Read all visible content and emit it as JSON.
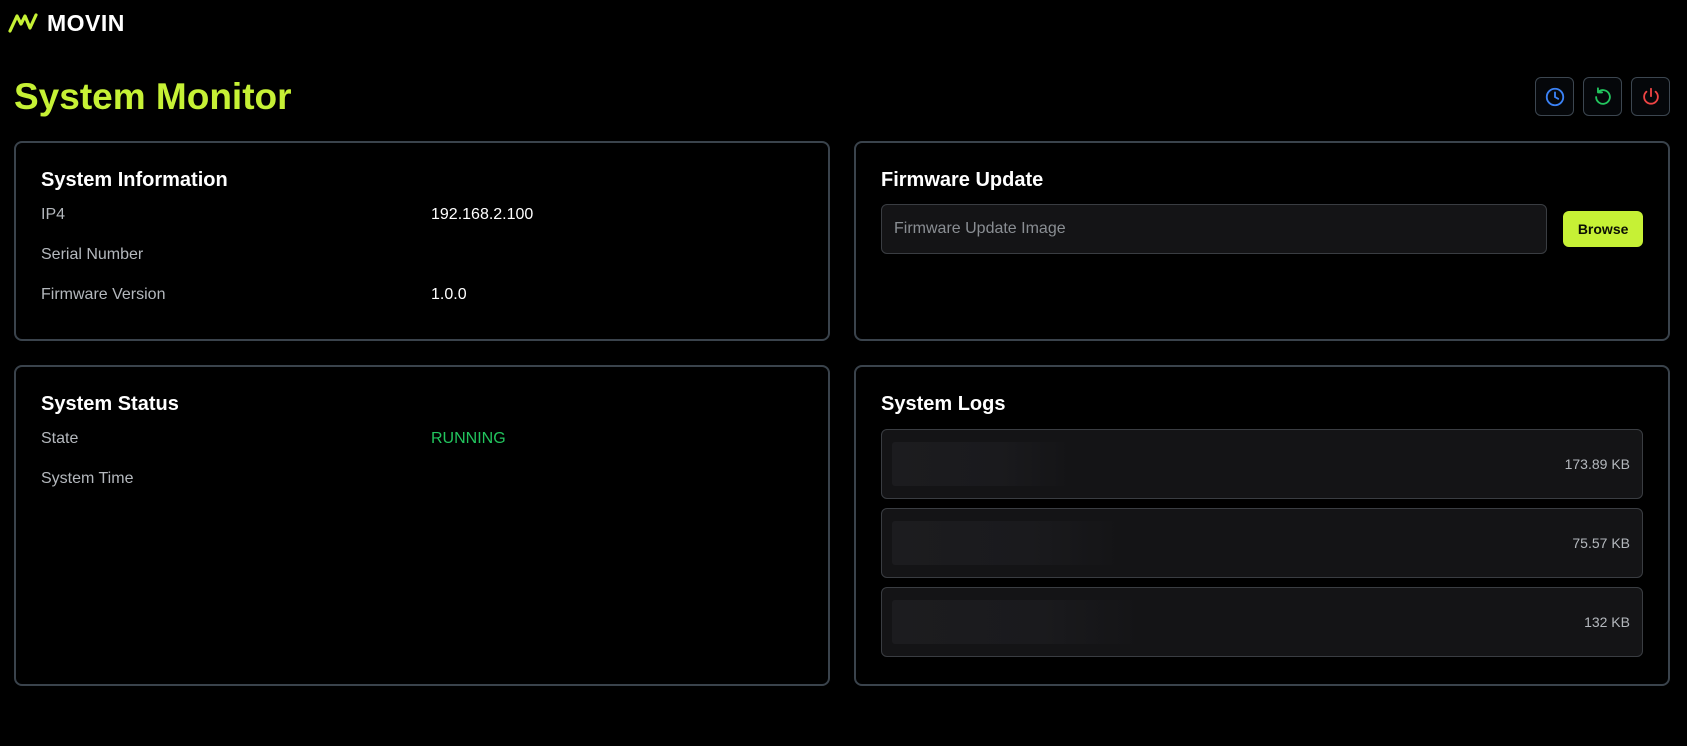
{
  "app": {
    "brand": "MOVIN"
  },
  "page": {
    "title": "System Monitor"
  },
  "actions": {
    "items": [
      {
        "icon": "clock-icon",
        "color": "#3b82f6"
      },
      {
        "icon": "restart-icon",
        "color": "#22c55e"
      },
      {
        "icon": "power-icon",
        "color": "#ef4444"
      }
    ]
  },
  "system_information": {
    "title": "System Information",
    "rows": [
      {
        "label": "IP4",
        "value": "192.168.2.100"
      },
      {
        "label": "Serial Number",
        "value": ""
      },
      {
        "label": "Firmware Version",
        "value": "1.0.0"
      }
    ]
  },
  "firmware_update": {
    "title": "Firmware Update",
    "input_placeholder": "Firmware Update Image",
    "input_value": "",
    "browse_label": "Browse"
  },
  "system_status": {
    "title": "System Status",
    "rows": [
      {
        "label": "State",
        "value": "RUNNING"
      },
      {
        "label": "System Time",
        "value": ""
      }
    ]
  },
  "system_logs": {
    "title": "System Logs",
    "items": [
      {
        "size": "173.89 KB"
      },
      {
        "size": "75.57 KB"
      },
      {
        "size": "132 KB"
      }
    ]
  },
  "colors": {
    "accent": "#c6f135",
    "status_running": "#22c55e",
    "card_border": "#3a434c",
    "background": "#000000"
  }
}
